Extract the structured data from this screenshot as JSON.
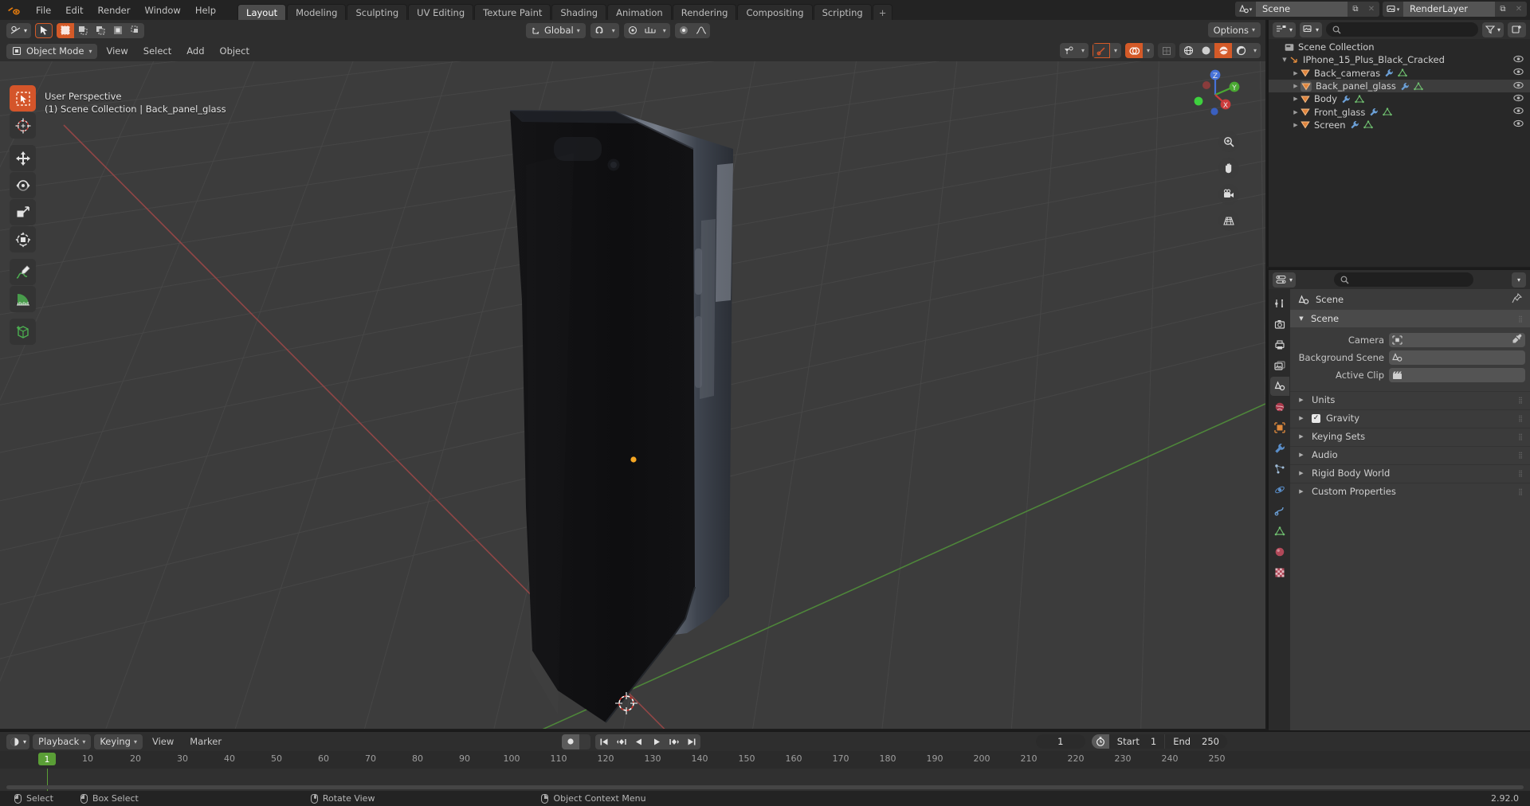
{
  "app": {
    "name": "Blender",
    "version": "2.92.0"
  },
  "topbar": {
    "logo_icon": "blender-logo-icon",
    "menus": [
      "File",
      "Edit",
      "Render",
      "Window",
      "Help"
    ],
    "workspace_tabs": [
      {
        "label": "Layout",
        "active": true
      },
      {
        "label": "Modeling",
        "active": false
      },
      {
        "label": "Sculpting",
        "active": false
      },
      {
        "label": "UV Editing",
        "active": false
      },
      {
        "label": "Texture Paint",
        "active": false
      },
      {
        "label": "Shading",
        "active": false
      },
      {
        "label": "Animation",
        "active": false
      },
      {
        "label": "Rendering",
        "active": false
      },
      {
        "label": "Compositing",
        "active": false
      },
      {
        "label": "Scripting",
        "active": false
      },
      {
        "label": "+",
        "active": false
      }
    ],
    "scene_selector": {
      "icon": "scene-icon",
      "value": "Scene",
      "new_icon": "duplicate-icon",
      "unlink_icon": "x-icon"
    },
    "viewlayer_selector": {
      "icon": "render-layers-icon",
      "value": "RenderLayer",
      "new_icon": "duplicate-icon",
      "unlink_icon": "x-icon"
    }
  },
  "viewport": {
    "tool_settings": {
      "editor_type_icon": "editor-type-icon",
      "active_tool_icon": "cursor-arrow-icon",
      "select_modes": [
        {
          "icon": "select-set-icon",
          "active": true
        },
        {
          "icon": "select-extend-icon",
          "active": false
        },
        {
          "icon": "select-subtract-icon",
          "active": false
        },
        {
          "icon": "select-invert-icon",
          "active": false
        },
        {
          "icon": "select-intersect-icon",
          "active": false
        }
      ],
      "transform_orientation": {
        "icon": "orientation-icon",
        "value": "Global"
      },
      "snapping": {
        "magnet_icon": "magnet-icon",
        "snap_to_icon": "snap-increment-icon"
      },
      "proportional_edit": {
        "icon": "proportional-edit-icon",
        "falloff_icon": "falloff-smooth-icon"
      },
      "options_label": "Options"
    },
    "header": {
      "mode_icon": "object-mode-icon",
      "mode_label": "Object Mode",
      "menus": [
        "View",
        "Select",
        "Add",
        "Object"
      ],
      "right_controls": [
        {
          "icon": "visibility-icon",
          "name": "object-type-visibility"
        },
        {
          "icon": "gizmo-icon",
          "name": "show-gizmo-toggle",
          "active": true
        },
        {
          "icon": "overlays-icon",
          "name": "show-overlays-toggle",
          "active": true
        },
        {
          "icon": "xray-icon",
          "name": "toggle-xray",
          "active": false
        }
      ],
      "shading_modes": [
        {
          "icon": "wireframe-icon",
          "active": false
        },
        {
          "icon": "solid-icon",
          "active": false
        },
        {
          "icon": "material-preview-icon",
          "active": true
        },
        {
          "icon": "rendered-icon",
          "active": false
        }
      ]
    },
    "toolbar": [
      {
        "name": "tweak-select-box-tool",
        "icon": "select-box-icon",
        "active": true
      },
      {
        "name": "cursor-tool",
        "icon": "cursor-3d-icon",
        "active": false
      },
      {
        "name": "move-tool",
        "icon": "move-icon",
        "active": false
      },
      {
        "name": "rotate-tool",
        "icon": "rotate-icon",
        "active": false
      },
      {
        "name": "scale-tool",
        "icon": "scale-icon",
        "active": false
      },
      {
        "name": "transform-tool",
        "icon": "transform-icon",
        "active": false
      },
      {
        "name": "annotate-tool",
        "icon": "annotate-pencil-icon",
        "active": false
      },
      {
        "name": "measure-tool",
        "icon": "measure-ruler-icon",
        "active": false
      },
      {
        "name": "add-cube-tool",
        "icon": "add-cube-icon",
        "active": false
      }
    ],
    "overlay_text": {
      "view_label": "User Perspective",
      "context_label": "(1) Scene Collection | Back_panel_glass"
    },
    "gizmo": {
      "axes": [
        {
          "label": "Z",
          "color": "#4772d8"
        },
        {
          "label": "Y",
          "color": "#4aa832"
        },
        {
          "label": "X",
          "color": "#cc3b3b"
        }
      ]
    },
    "nav_buttons": [
      {
        "name": "zoom-view-button",
        "icon": "magnifier-plus-icon"
      },
      {
        "name": "pan-view-button",
        "icon": "hand-icon"
      },
      {
        "name": "camera-view-button",
        "icon": "camera-icon"
      },
      {
        "name": "toggle-perspective-button",
        "icon": "grid-perspective-icon"
      }
    ]
  },
  "outliner": {
    "display_mode_icon": "outliner-display-icon",
    "filter_id_icon": "view-layer-icon",
    "search_placeholder": "",
    "search_icon": "search-icon",
    "filter_icon": "funnel-icon",
    "new_collection_icon": "new-collection-icon",
    "rows": [
      {
        "label": "Scene Collection",
        "icon": "collection-icon",
        "depth": 0,
        "expandable": false,
        "active": false,
        "has_eye": false,
        "extras": []
      },
      {
        "label": "IPhone_15_Plus_Black_Cracked",
        "icon": "empty-axes-icon",
        "depth": 1,
        "expandable": true,
        "expanded": true,
        "active": false,
        "has_eye": true,
        "extras": []
      },
      {
        "label": "Back_cameras",
        "icon": "mesh-object-icon",
        "depth": 2,
        "expandable": true,
        "expanded": false,
        "active": false,
        "has_eye": true,
        "extras": [
          "modifier-icon",
          "mesh-data-icon"
        ]
      },
      {
        "label": "Back_panel_glass",
        "icon": "mesh-object-icon",
        "depth": 2,
        "expandable": true,
        "expanded": false,
        "active": true,
        "has_eye": true,
        "extras": [
          "modifier-icon",
          "mesh-data-icon"
        ]
      },
      {
        "label": "Body",
        "icon": "mesh-object-icon",
        "depth": 2,
        "expandable": true,
        "expanded": false,
        "active": false,
        "has_eye": true,
        "extras": [
          "modifier-icon",
          "mesh-data-icon"
        ]
      },
      {
        "label": "Front_glass",
        "icon": "mesh-object-icon",
        "depth": 2,
        "expandable": true,
        "expanded": false,
        "active": false,
        "has_eye": true,
        "extras": [
          "modifier-icon",
          "mesh-data-icon"
        ]
      },
      {
        "label": "Screen",
        "icon": "mesh-object-icon",
        "depth": 2,
        "expandable": true,
        "expanded": false,
        "active": false,
        "has_eye": true,
        "extras": [
          "modifier-icon",
          "mesh-data-icon"
        ]
      }
    ]
  },
  "properties": {
    "editor_icon": "properties-editor-icon",
    "search_placeholder": "",
    "search_icon": "search-icon",
    "options_icon": "chevron-down-icon",
    "tabs": [
      {
        "name": "tool-tab",
        "icon": "tool-icon",
        "active": false
      },
      {
        "name": "render-tab",
        "icon": "render-camera-icon",
        "active": false
      },
      {
        "name": "output-tab",
        "icon": "printer-icon",
        "active": false
      },
      {
        "name": "view-layer-tab",
        "icon": "images-icon",
        "active": false
      },
      {
        "name": "scene-tab",
        "icon": "scene-cone-icon",
        "active": true
      },
      {
        "name": "world-tab",
        "icon": "world-globe-icon",
        "active": false
      },
      {
        "name": "object-tab",
        "icon": "object-square-icon",
        "active": false
      },
      {
        "name": "modifier-tab",
        "icon": "wrench-icon",
        "active": false
      },
      {
        "name": "particles-tab",
        "icon": "particles-icon",
        "active": false
      },
      {
        "name": "physics-tab",
        "icon": "physics-orbit-icon",
        "active": false
      },
      {
        "name": "constraints-tab",
        "icon": "constraint-icon",
        "active": false
      },
      {
        "name": "data-tab",
        "icon": "mesh-data-icon",
        "active": false
      },
      {
        "name": "material-tab",
        "icon": "material-sphere-icon",
        "active": false
      },
      {
        "name": "texture-tab",
        "icon": "checker-texture-icon",
        "active": false
      }
    ],
    "breadcrumb": {
      "icon": "scene-cone-icon",
      "label": "Scene",
      "pin_icon": "pin-icon"
    },
    "scene_panel": {
      "title": "Scene",
      "expanded": true,
      "fields": [
        {
          "label": "Camera",
          "icon": "camera-data-icon",
          "value": "",
          "eyedropper": true
        },
        {
          "label": "Background Scene",
          "icon": "scene-cone-icon",
          "value": "",
          "eyedropper": false
        },
        {
          "label": "Active Clip",
          "icon": "movie-clip-icon",
          "value": "",
          "eyedropper": false
        }
      ]
    },
    "sub_panels": [
      {
        "label": "Units",
        "expanded": false,
        "checkbox": null
      },
      {
        "label": "Gravity",
        "expanded": false,
        "checkbox": true
      },
      {
        "label": "Keying Sets",
        "expanded": false,
        "checkbox": null
      },
      {
        "label": "Audio",
        "expanded": false,
        "checkbox": null
      },
      {
        "label": "Rigid Body World",
        "expanded": false,
        "checkbox": null
      },
      {
        "label": "Custom Properties",
        "expanded": false,
        "checkbox": null
      }
    ]
  },
  "timeline": {
    "editor_icon": "timeline-editor-icon",
    "menus": [
      {
        "label": "Playback",
        "dropdown": true
      },
      {
        "label": "Keying",
        "dropdown": true
      },
      {
        "label": "View",
        "dropdown": false
      },
      {
        "label": "Marker",
        "dropdown": false
      }
    ],
    "record_icon": "record-keyframe-icon",
    "transport": [
      {
        "name": "jump-to-start-button",
        "icon": "jump-start-icon"
      },
      {
        "name": "previous-keyframe-button",
        "icon": "prev-keyframe-icon"
      },
      {
        "name": "play-reverse-button",
        "icon": "play-reverse-icon"
      },
      {
        "name": "play-button",
        "icon": "play-icon"
      },
      {
        "name": "next-keyframe-button",
        "icon": "next-keyframe-icon"
      },
      {
        "name": "jump-to-end-button",
        "icon": "jump-end-icon"
      }
    ],
    "current_frame": "1",
    "range_icon": "stopwatch-icon",
    "start_label": "Start",
    "start_value": "1",
    "end_label": "End",
    "end_value": "250",
    "ticks": [
      "10",
      "20",
      "30",
      "40",
      "50",
      "60",
      "70",
      "80",
      "90",
      "100",
      "110",
      "120",
      "130",
      "140",
      "150",
      "160",
      "170",
      "180",
      "190",
      "200",
      "210",
      "220",
      "230",
      "240",
      "250"
    ],
    "playhead_frame": "1"
  },
  "status_bar": {
    "items": [
      {
        "mouse": "left",
        "label": "Select"
      },
      {
        "mouse": "left-drag",
        "label": "Box Select"
      },
      {
        "mouse": "middle",
        "label": "Rotate View"
      },
      {
        "mouse": "right",
        "label": "Object Context Menu"
      }
    ],
    "version": "2.92.0"
  },
  "colors": {
    "accent_orange": "#d4552a",
    "header_bg": "#2e2e2e",
    "viewport_bg": "#3c3c3c",
    "axis_x": "#cc3b3b",
    "axis_y": "#4aa832",
    "axis_z": "#4772d8",
    "playhead_green": "#5a9e36"
  }
}
